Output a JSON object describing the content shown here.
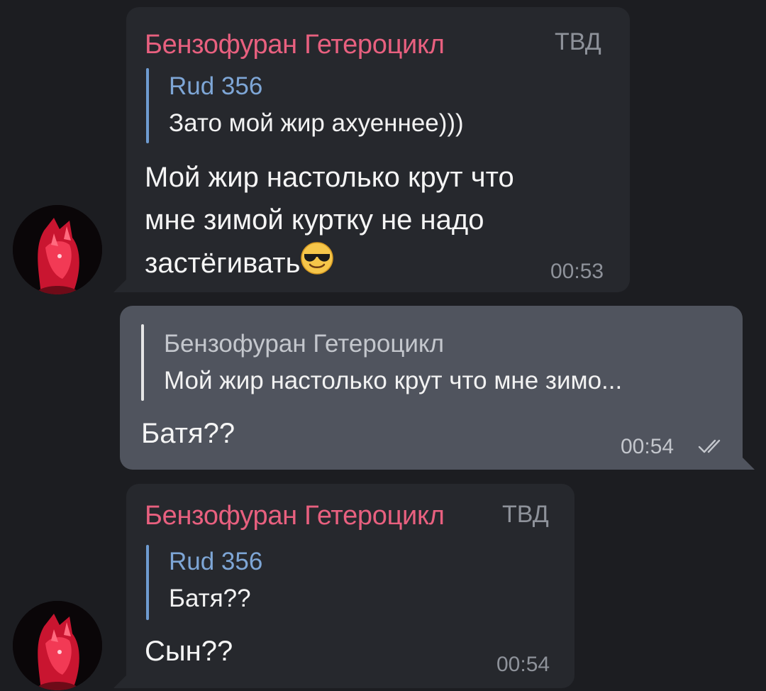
{
  "messages": [
    {
      "sender": "Бензофуран Гетероцикл",
      "tag": "ТВД",
      "reply": {
        "name": "Rud 356",
        "text": "Зато мой жир ахуеннее)))"
      },
      "lines": [
        "Мой жир настолько крут что",
        "мне зимой куртку не надо",
        "застёгивать"
      ],
      "emoji": "sunglasses-emoji",
      "time": "00:53"
    },
    {
      "reply": {
        "name": "Бензофуран Гетероцикл",
        "text": "Мой жир настолько крут что мне зимо..."
      },
      "text": "Батя??",
      "time": "00:54",
      "status_icon": "double-check-icon"
    },
    {
      "sender": "Бензофуран Гетероцикл",
      "tag": "ТВД",
      "reply": {
        "name": "Rud 356",
        "text": "Батя??"
      },
      "text": "Сын??",
      "time": "00:54"
    }
  ],
  "colors": {
    "background": "#1c1d21",
    "incoming_bubble": "#26282d",
    "outgoing_bubble": "#50545e",
    "sender_name": "#e8607f",
    "reply_accent_in": "#6e9bd0",
    "reply_accent_out": "#e6e6e6",
    "meta_text": "#8e929a"
  }
}
